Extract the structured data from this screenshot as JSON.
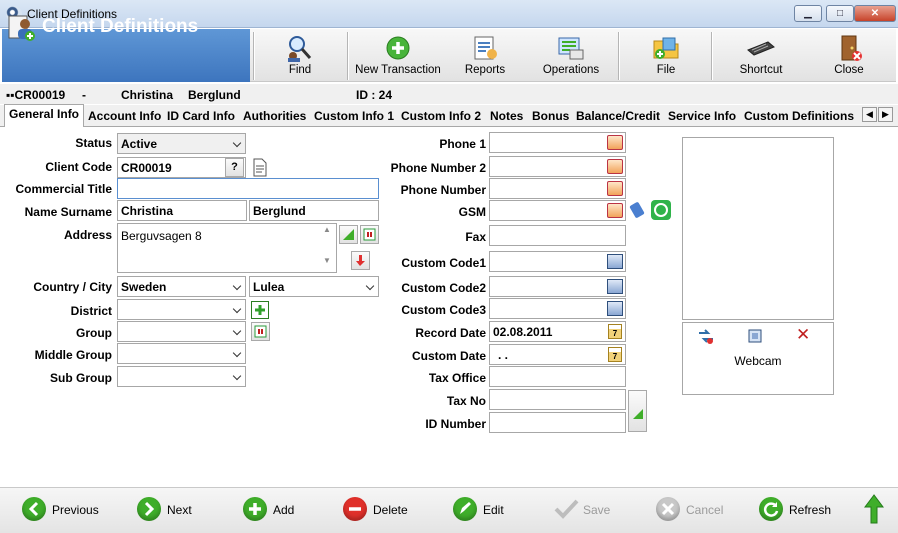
{
  "window": {
    "title": "Client Definitions",
    "min": "▁",
    "max": "□",
    "close": "✕"
  },
  "banner": {
    "title": "Client Definitions"
  },
  "toolbar": {
    "find": "Find",
    "new_transaction": "New Transaction",
    "reports": "Reports",
    "operations": "Operations",
    "file": "File",
    "shortcut": "Shortcut",
    "close": "Close"
  },
  "infostrip": {
    "code": "CR00019",
    "sep1": "-",
    "name": "Christina",
    "surname": "Berglund",
    "id": "ID : 24"
  },
  "tabs": [
    "General Info",
    "Account Info",
    "ID Card Info",
    "Authorities",
    "Custom Info 1",
    "Custom Info 2",
    "Notes",
    "Bonus",
    "Balance/Credit",
    "Service Info",
    "Custom Definitions"
  ],
  "form": {
    "status": {
      "label": "Status",
      "value": "Active"
    },
    "client_code": {
      "label": "Client Code",
      "value": "CR00019",
      "help": "?"
    },
    "commercial_title": {
      "label": "Commercial Title",
      "value": ""
    },
    "name_surname": {
      "label": "Name Surname",
      "first": "Christina",
      "last": "Berglund"
    },
    "address": {
      "label": "Address",
      "value": "Berguvsagen 8"
    },
    "country_city": {
      "label": "Country / City",
      "country": "Sweden",
      "city": "Lulea"
    },
    "district": {
      "label": "District",
      "value": ""
    },
    "group": {
      "label": "Group",
      "value": ""
    },
    "middle_group": {
      "label": "Middle Group",
      "value": ""
    },
    "sub_group": {
      "label": "Sub Group",
      "value": ""
    },
    "phone1": {
      "label": "Phone 1",
      "value": ""
    },
    "phone_number2": {
      "label": "Phone Number 2",
      "value": ""
    },
    "phone_number": {
      "label": "Phone Number",
      "value": ""
    },
    "gsm": {
      "label": "GSM",
      "value": ""
    },
    "fax": {
      "label": "Fax",
      "value": ""
    },
    "custom_code1": {
      "label": "Custom Code1",
      "value": ""
    },
    "custom_code2": {
      "label": "Custom Code2",
      "value": ""
    },
    "custom_code3": {
      "label": "Custom Code3",
      "value": ""
    },
    "record_date": {
      "label": "Record Date",
      "value": "02.08.2011"
    },
    "custom_date": {
      "label": "Custom Date",
      "value": ". ."
    },
    "tax_office": {
      "label": "Tax Office",
      "value": ""
    },
    "tax_no": {
      "label": "Tax No",
      "value": ""
    },
    "id_number": {
      "label": "ID Number",
      "value": ""
    }
  },
  "photo": {
    "webcam": "Webcam"
  },
  "bottom": {
    "previous": "Previous",
    "next": "Next",
    "add": "Add",
    "delete": "Delete",
    "edit": "Edit",
    "save": "Save",
    "cancel": "Cancel",
    "refresh": "Refresh"
  },
  "colors": {
    "banner": "#4a84c8",
    "green": "#3fae2a",
    "red": "#e0302a",
    "gray": "#bdbdbd"
  }
}
